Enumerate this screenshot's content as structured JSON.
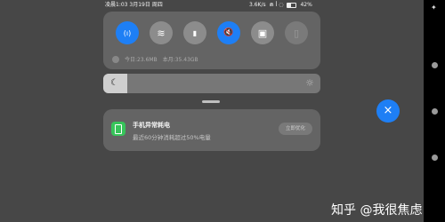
{
  "status_bar": {
    "time_date": "凌晨1:03 3月19日 周四",
    "net_speed": "3.6K/s",
    "signal_text": "⋒ ꟾ ◌",
    "battery": "42%"
  },
  "quick_settings": {
    "tiles": [
      {
        "name": "mobile-data",
        "icon": "(ı)",
        "state": "on"
      },
      {
        "name": "wifi",
        "icon": "≋",
        "state": "off"
      },
      {
        "name": "flashlight",
        "icon": "▮",
        "state": "off"
      },
      {
        "name": "mute",
        "icon": "🔇",
        "state": "on"
      },
      {
        "name": "screen-cast",
        "icon": "▣",
        "state": "off"
      },
      {
        "name": "sim",
        "icon": "▯",
        "state": "disabled"
      }
    ],
    "today_usage": "今日:23.6MB",
    "month_usage": "本月:35.43GB"
  },
  "brightness": {
    "level": 0.11
  },
  "notification": {
    "title": "手机异常耗电",
    "body": "最近60分钟消耗超过50%电量",
    "action_label": "立即优化"
  },
  "close_button": {
    "label": "×"
  },
  "watermark": "知乎 @我很焦虑",
  "colors": {
    "accent": "#1e7ff5",
    "panel": "#646464",
    "background": "#474747",
    "battery_icon": "#37c45a"
  }
}
